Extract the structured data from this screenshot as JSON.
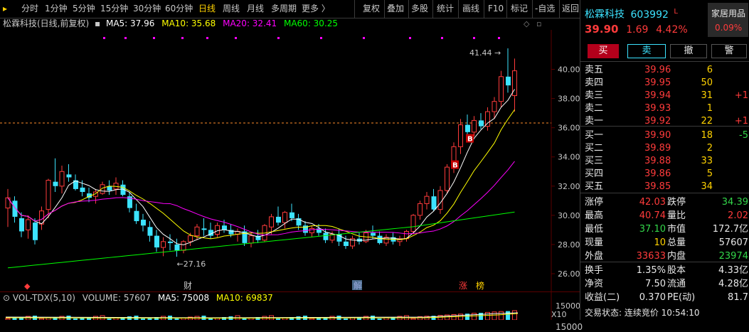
{
  "toolbar": {
    "items": [
      "分时",
      "1分钟",
      "5分钟",
      "15分钟",
      "30分钟",
      "60分钟",
      "日线",
      "周线",
      "月线",
      "多周期",
      "更多 〉"
    ],
    "active_index": 6,
    "right_items": [
      "复权",
      "叠加",
      "多股",
      "统计",
      "画线",
      "F10",
      "标记",
      "-自选",
      "返回"
    ]
  },
  "chart": {
    "stock_label": "松霖科技(日线,前复权)",
    "ma5": "MA5: 37.96",
    "ma10": "MA10: 35.68",
    "ma20": "MA20: 32.41",
    "ma60": "MA60: 30.25",
    "high_marker": "41.44",
    "low_marker": "27.16",
    "axis_labels": [
      "40.00",
      "38.00",
      "36.00",
      "34.00",
      "32.00",
      "30.00",
      "28.00",
      "26.00"
    ],
    "markers": [
      "财",
      "解",
      "涨",
      "榜"
    ],
    "buy_markers": [
      "B",
      "B"
    ]
  },
  "volume": {
    "label": "VOL-TDX(5,10)",
    "volume": "VOLUME: 57607",
    "ma5": "MA5: 75008",
    "ma10": "MA10: 69837",
    "axis_top": "15000",
    "unit": "X10"
  },
  "colors": {
    "up": "#ff3b3b",
    "down": "#3ce3ff",
    "ma5": "#ffffff",
    "ma10": "#ffff00",
    "ma20": "#ff00ff",
    "ma60": "#00ff00"
  },
  "quote": {
    "name": "松霖科技",
    "code": "603992",
    "tag": "L",
    "sector": "家居用品",
    "sector_change": "0.09%",
    "price": "39.90",
    "change": "1.69",
    "pct": "4.42%",
    "btn_buy": "买",
    "btn_sell": "卖",
    "btn_cancel": "撤",
    "btn_alert": "警",
    "asks": [
      {
        "label": "卖五",
        "price": "39.96",
        "vol": "6",
        "chg": ""
      },
      {
        "label": "卖四",
        "price": "39.95",
        "vol": "50",
        "chg": ""
      },
      {
        "label": "卖三",
        "price": "39.94",
        "vol": "31",
        "chg": "+1"
      },
      {
        "label": "卖二",
        "price": "39.93",
        "vol": "1",
        "chg": ""
      },
      {
        "label": "卖一",
        "price": "39.92",
        "vol": "22",
        "chg": "+1"
      }
    ],
    "bids": [
      {
        "label": "买一",
        "price": "39.90",
        "vol": "18",
        "chg": "-5"
      },
      {
        "label": "买二",
        "price": "39.89",
        "vol": "2",
        "chg": ""
      },
      {
        "label": "买三",
        "price": "39.88",
        "vol": "33",
        "chg": ""
      },
      {
        "label": "买四",
        "price": "39.86",
        "vol": "5",
        "chg": ""
      },
      {
        "label": "买五",
        "price": "39.85",
        "vol": "34",
        "chg": ""
      }
    ],
    "stats": [
      {
        "l1": "涨停",
        "v1": "42.03",
        "l2": "跌停",
        "v2": "34.39"
      },
      {
        "l1": "最高",
        "v1": "40.74",
        "l2": "量比",
        "v2": "2.02"
      },
      {
        "l1": "最低",
        "v1": "37.10",
        "l2": "市值",
        "v2": "172.7亿"
      },
      {
        "l1": "现量",
        "v1": "10",
        "l2": "总量",
        "v2": "57607"
      },
      {
        "l1": "外盘",
        "v1": "33633",
        "l2": "内盘",
        "v2": "23974"
      }
    ],
    "stats2": [
      {
        "l1": "换手",
        "v1": "1.35%",
        "l2": "股本",
        "v2": "4.33亿"
      },
      {
        "l1": "净资",
        "v1": "7.50",
        "l2": "流通",
        "v2": "4.28亿"
      },
      {
        "l1": "收益(二)",
        "v1": "0.370",
        "l2": "PE(动)",
        "v2": "81.7"
      }
    ],
    "trade_status": "交易状态: 连续竞价 10:54:10"
  }
}
